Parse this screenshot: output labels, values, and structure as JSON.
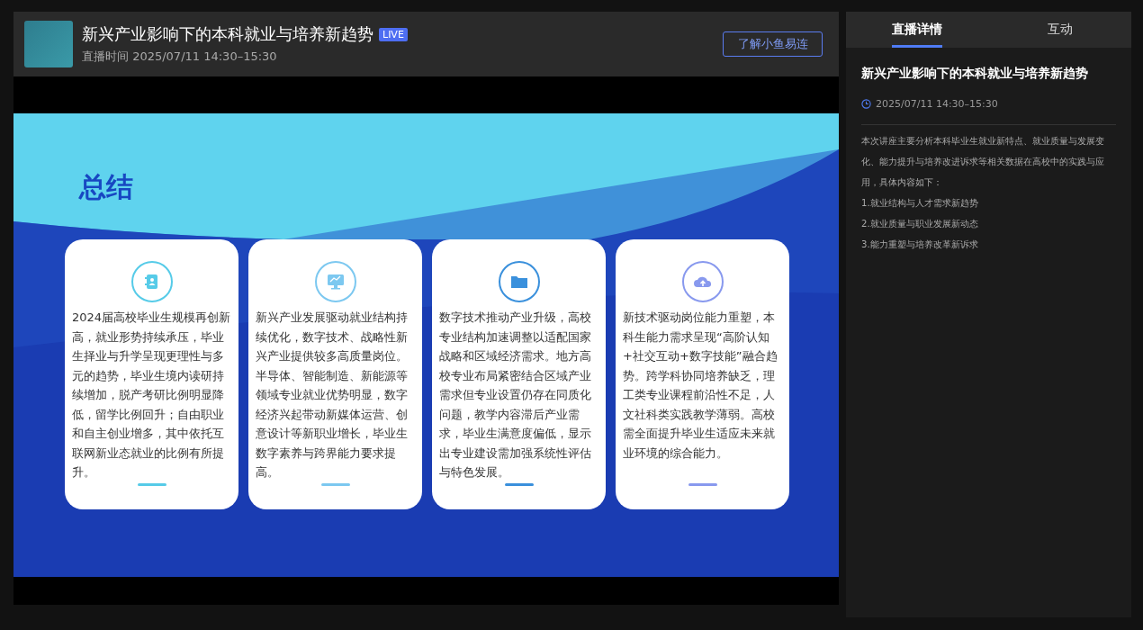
{
  "header": {
    "title": "新兴产业影响下的本科就业与培养新趋势",
    "badge": "LIVE",
    "subtitle": "直播时间 2025/07/11 14:30–15:30",
    "button": "了解小鱼易连"
  },
  "slide": {
    "title": "总结",
    "cards": [
      {
        "color": "#56cbe8",
        "text": "2024届高校毕业生规模再创新高，就业形势持续承压，毕业生择业与升学呈现更理性与多元的趋势，毕业生境内读研持续增加，脱产考研比例明显降低，留学比例回升；自由职业和自主创业增多，其中依托互联网新业态就业的比例有所提升。"
      },
      {
        "color": "#7cc8f0",
        "text": "新兴产业发展驱动就业结构持续优化，数字技术、战略性新兴产业提供较多高质量岗位。半导体、智能制造、新能源等领域专业就业优势明显，数字经济兴起带动新媒体运营、创意设计等新职业增长，毕业生数字素养与跨界能力要求提高。"
      },
      {
        "color": "#3a90dc",
        "text": "数字技术推动产业升级，高校专业结构加速调整以适配国家战略和区域经济需求。地方高校专业布局紧密结合区域产业需求但专业设置仍存在同质化问题，教学内容滞后产业需求，毕业生满意度偏低，显示出专业建设需加强系统性评估与特色发展。"
      },
      {
        "color": "#8899ee",
        "text": "新技术驱动岗位能力重塑，本科生能力需求呈现“高阶认知+社交互动+数字技能”融合趋势。跨学科协同培养缺乏，理工类专业课程前沿性不足，人文社科类实践教学薄弱。高校需全面提升毕业生适应未来就业环境的综合能力。"
      }
    ]
  },
  "sidebar": {
    "tabs": [
      {
        "label": "直播详情",
        "selected": true
      },
      {
        "label": "互动",
        "selected": false
      }
    ],
    "title": "新兴产业影响下的本科就业与培养新趋势",
    "time": "2025/07/11 14:30–15:30",
    "description": [
      "本次讲座主要分析本科毕业生就业新特点、就业质量与发展变化、能力提升与培养改进诉求等相关数据在高校中的实践与应用，具体内容如下：",
      "1.就业结构与人才需求新趋势",
      "2.就业质量与职业发展新动态",
      "3.能力重塑与培养改革新诉求"
    ]
  }
}
